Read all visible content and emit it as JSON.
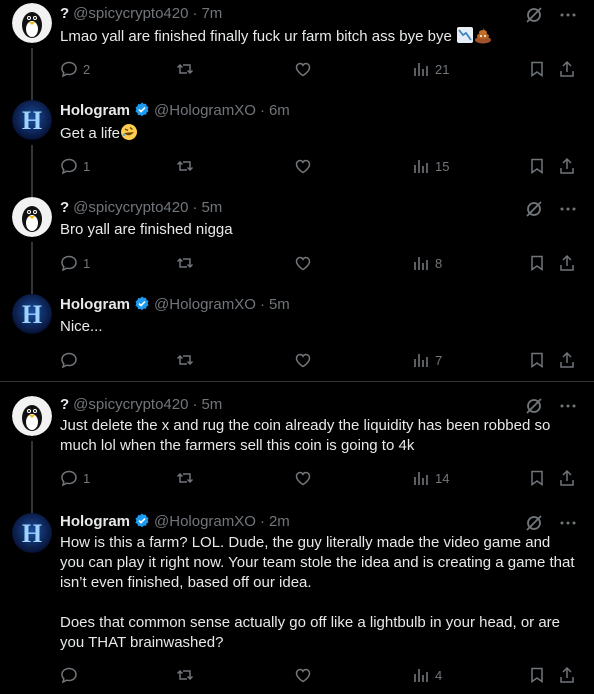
{
  "tweets": [
    {
      "name": "?",
      "handle": "@spicycrypto420",
      "time": "7m",
      "verified": false,
      "avatar": "penguin",
      "paragraphs": [
        "Lmao yall are finished finally fuck ur farm bitch ass bye bye"
      ],
      "emojis": [
        "chart-decreasing-emoji",
        "pile-of-poo-emoji"
      ],
      "replies": "2",
      "retweets": "",
      "likes": "",
      "views": "21"
    },
    {
      "name": "Hologram",
      "handle": "@HologramXO",
      "time": "6m",
      "verified": true,
      "avatar": "hologram",
      "paragraphs": [
        "Get a life"
      ],
      "emojis": [
        "rolling-on-floor-laughing-emoji"
      ],
      "replies": "1",
      "retweets": "",
      "likes": "",
      "views": "15"
    },
    {
      "name": "?",
      "handle": "@spicycrypto420",
      "time": "5m",
      "verified": false,
      "avatar": "penguin",
      "paragraphs": [
        "Bro yall are finished nigga"
      ],
      "emojis": [],
      "replies": "1",
      "retweets": "",
      "likes": "",
      "views": "8"
    },
    {
      "name": "Hologram",
      "handle": "@HologramXO",
      "time": "5m",
      "verified": true,
      "avatar": "hologram",
      "paragraphs": [
        "Nice..."
      ],
      "emojis": [],
      "replies": "",
      "retweets": "",
      "likes": "",
      "views": "7"
    },
    {
      "name": "?",
      "handle": "@spicycrypto420",
      "time": "5m",
      "verified": false,
      "avatar": "penguin",
      "paragraphs": [
        "Just delete the x and rug the coin already the liquidity has been robbed so much lol when the farmers sell this coin is going to 4k"
      ],
      "emojis": [],
      "replies": "1",
      "retweets": "",
      "likes": "",
      "views": "14"
    },
    {
      "name": "Hologram",
      "handle": "@HologramXO",
      "time": "2m",
      "verified": true,
      "avatar": "hologram",
      "paragraphs": [
        "How is this a farm? LOL. Dude, the guy literally made the video game and you can play it right now. Your team stole the idea and is creating a game that isn’t even finished, based off our idea.",
        "Does that common sense actually go off like a lightbulb in your head, or are you THAT brainwashed?"
      ],
      "emojis": [],
      "replies": "",
      "retweets": "",
      "likes": "",
      "views": "4"
    }
  ],
  "separator": "·",
  "icons": {
    "grok": "grok-icon",
    "more": "more-icon",
    "reply": "reply-icon",
    "retweet": "retweet-icon",
    "like": "like-icon",
    "views": "views-icon",
    "bookmark": "bookmark-icon",
    "share": "share-icon",
    "verified": "verified-badge-icon"
  },
  "colors": {
    "background": "#000000",
    "text": "#e7e9ea",
    "muted": "#71767b",
    "verified": "#1d9bf0",
    "line": "#333639"
  }
}
